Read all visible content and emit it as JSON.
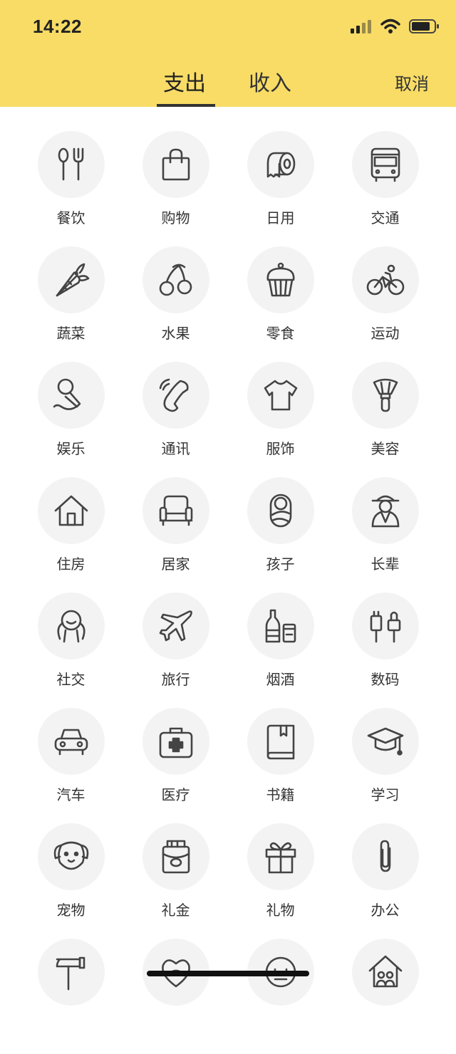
{
  "status_bar": {
    "time": "14:22"
  },
  "tabs": [
    {
      "label": "支出",
      "active": true
    },
    {
      "label": "收入",
      "active": false
    }
  ],
  "cancel_label": "取消",
  "colors": {
    "header_bg": "#f8dc66",
    "icon_bg": "#f3f3f3",
    "icon_stroke": "#444444"
  },
  "categories": [
    {
      "label": "餐饮",
      "icon": "utensils-icon"
    },
    {
      "label": "购物",
      "icon": "shopping-bag-icon"
    },
    {
      "label": "日用",
      "icon": "toilet-paper-icon"
    },
    {
      "label": "交通",
      "icon": "bus-icon"
    },
    {
      "label": "蔬菜",
      "icon": "carrot-icon"
    },
    {
      "label": "水果",
      "icon": "cherry-icon"
    },
    {
      "label": "零食",
      "icon": "cupcake-icon"
    },
    {
      "label": "运动",
      "icon": "bicycle-icon"
    },
    {
      "label": "娱乐",
      "icon": "microphone-icon"
    },
    {
      "label": "通讯",
      "icon": "phone-icon"
    },
    {
      "label": "服饰",
      "icon": "tshirt-icon"
    },
    {
      "label": "美容",
      "icon": "makeup-brush-icon"
    },
    {
      "label": "住房",
      "icon": "house-icon"
    },
    {
      "label": "居家",
      "icon": "armchair-icon"
    },
    {
      "label": "孩子",
      "icon": "baby-icon"
    },
    {
      "label": "长辈",
      "icon": "elder-icon"
    },
    {
      "label": "社交",
      "icon": "people-icon"
    },
    {
      "label": "旅行",
      "icon": "airplane-icon"
    },
    {
      "label": "烟酒",
      "icon": "bottle-icon"
    },
    {
      "label": "数码",
      "icon": "plug-icon"
    },
    {
      "label": "汽车",
      "icon": "car-icon"
    },
    {
      "label": "医疗",
      "icon": "medical-kit-icon"
    },
    {
      "label": "书籍",
      "icon": "book-icon"
    },
    {
      "label": "学习",
      "icon": "graduation-cap-icon"
    },
    {
      "label": "宠物",
      "icon": "dog-icon"
    },
    {
      "label": "礼金",
      "icon": "red-envelope-icon"
    },
    {
      "label": "礼物",
      "icon": "gift-icon"
    },
    {
      "label": "办公",
      "icon": "paperclip-icon"
    },
    {
      "label": "",
      "icon": "hammer-icon"
    },
    {
      "label": "",
      "icon": "heart-icon"
    },
    {
      "label": "",
      "icon": "face-icon"
    },
    {
      "label": "",
      "icon": "family-house-icon"
    }
  ]
}
